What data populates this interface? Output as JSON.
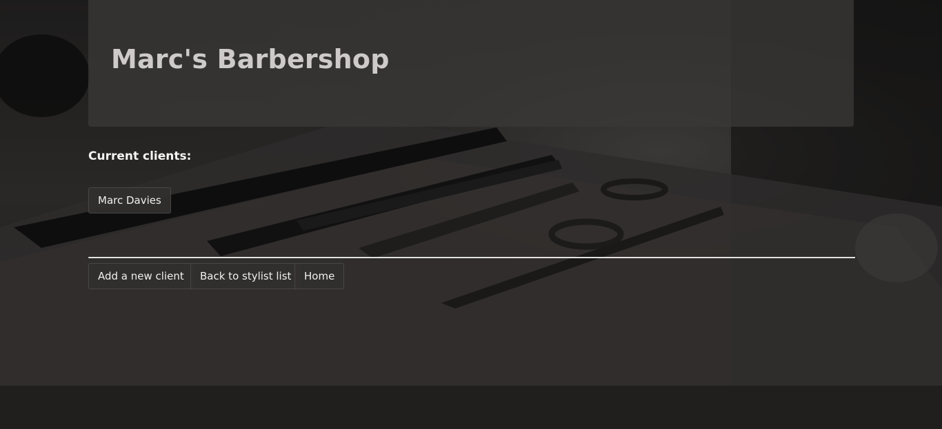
{
  "header": {
    "title": "Marc's Barbershop"
  },
  "clients_section": {
    "heading": "Current clients:",
    "clients": [
      {
        "name": "Marc Davies"
      }
    ]
  },
  "actions": {
    "add_client_label": "Add a new client",
    "back_label": "Back to stylist list",
    "home_label": "Home"
  },
  "background": {
    "description_icon": "barber-tools-photo"
  },
  "colors": {
    "page_background": "#1b1a1a",
    "jumbotron_background": "#3a3837",
    "title_text": "#cfcaca",
    "button_background": "#32302f",
    "button_text": "#f0f0f0",
    "divider": "#d8d8d8"
  }
}
